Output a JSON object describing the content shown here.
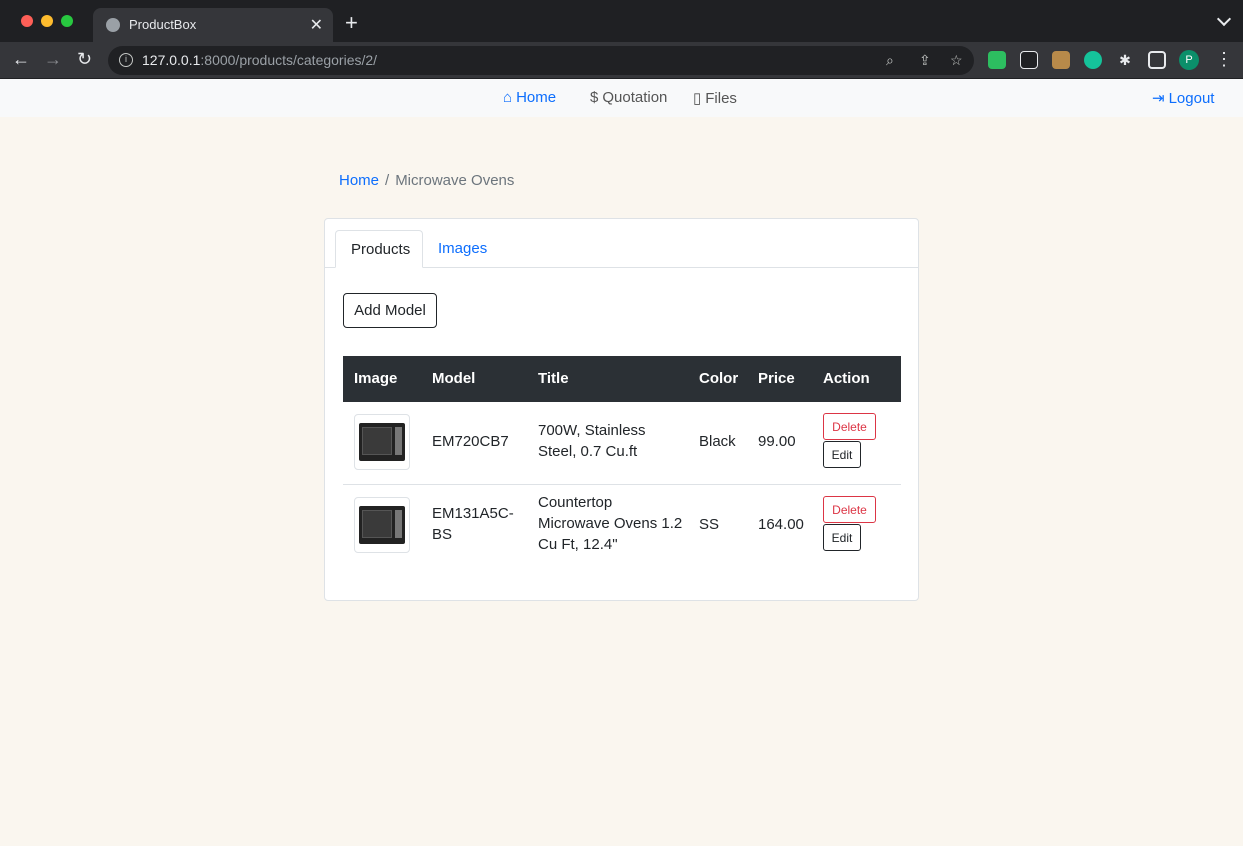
{
  "browser": {
    "tab_title": "ProductBox",
    "url_host": "127.0.0.1",
    "url_path": ":8000/products/categories/2/",
    "profile_initial": "P"
  },
  "navbar": {
    "home": "Home",
    "quotation": "Quotation",
    "files": "Files",
    "logout": "Logout"
  },
  "breadcrumb": {
    "home": "Home",
    "separator": "/",
    "current": "Microwave Ovens"
  },
  "tabs": {
    "products": "Products",
    "images": "Images"
  },
  "add_model_label": "Add Model",
  "table": {
    "headers": [
      "Image",
      "Model",
      "Title",
      "Color",
      "Price",
      "Action"
    ],
    "rows": [
      {
        "model": "EM720CB7",
        "title_line1": "700W, Stainless",
        "title_line2": "Steel, 0.7 Cu.ft",
        "color": "Black",
        "price": "99.00",
        "delete_label": "Delete",
        "edit_label": "Edit"
      },
      {
        "model_line1": "EM131A5C-",
        "model_line2": "BS",
        "title_line1": "Countertop",
        "title_line2": "Microwave Ovens 1.2",
        "title_line3": "Cu Ft, 12.4\"",
        "color": "SS",
        "price": "164.00",
        "delete_label": "Delete",
        "edit_label": "Edit"
      }
    ]
  },
  "colors": {
    "link": "#0d6efd",
    "danger": "#dc3545",
    "table_header": "#2b3035",
    "page_bg": "#faf6ef"
  }
}
